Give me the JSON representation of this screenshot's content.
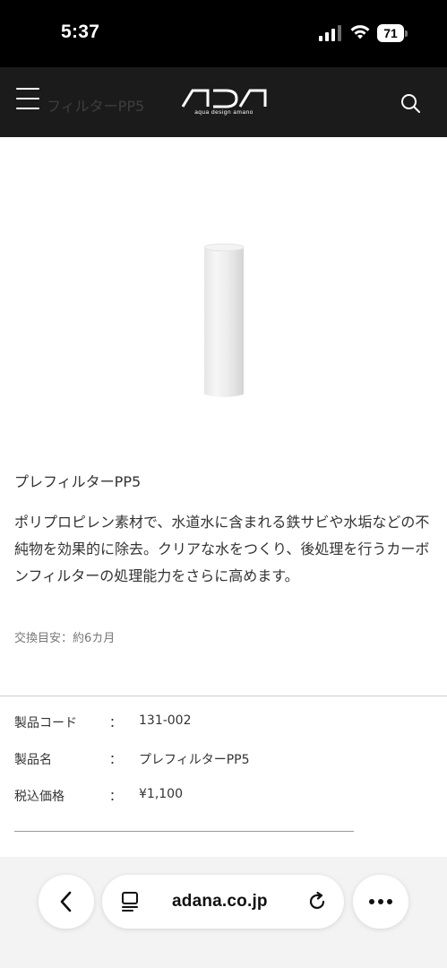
{
  "status_bar": {
    "time": "5:37",
    "battery": "71",
    "icons": [
      "cellular-signal-icon",
      "wifi-icon",
      "battery-icon"
    ]
  },
  "header": {
    "ghost_title": "フィルターPP5",
    "logo_text": "ADA",
    "logo_tagline": "aqua design amano",
    "menu_icon": "hamburger-menu-icon",
    "search_icon": "search-icon"
  },
  "product": {
    "title": "プレフィルターPP5",
    "description": "ポリプロピレン素材で、水道水に含まれる鉄サビや水垢などの不純物を効果的に除去。クリアな水をつくり、後処理を行うカーボンフィルターの処理能力をさらに高めます。",
    "replace_note": "交換目安：約6カ月"
  },
  "specs": [
    {
      "key": "製品コード",
      "sep": "：",
      "value": "131-002"
    },
    {
      "key": "製品名",
      "sep": "：",
      "value": "プレフィルターPP5"
    },
    {
      "key": "税込価格",
      "sep": "：",
      "value": "¥1,100"
    }
  ],
  "browser": {
    "url": "adana.co.jp",
    "back_icon": "chevron-left-icon",
    "tabs_icon": "page-menu-icon",
    "reload_icon": "reload-icon",
    "more_icon": "more-dots-icon"
  },
  "colors": {
    "status_bar_bg": "#000000",
    "header_bg": "#1b1b1b",
    "page_bg": "#ffffff",
    "text": "#333333",
    "browser_bar_bg": "#f3f3f3"
  }
}
